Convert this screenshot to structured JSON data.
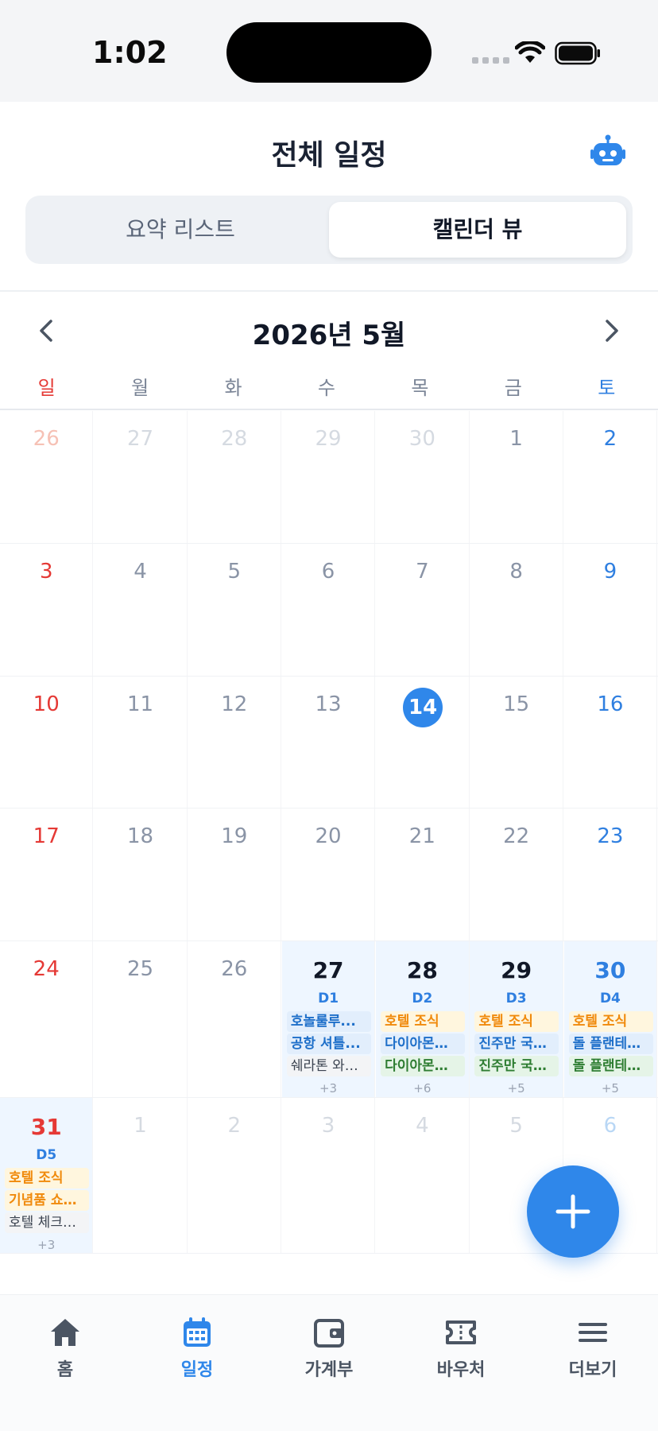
{
  "status_bar": {
    "time": "1:02"
  },
  "header": {
    "title": "전체 일정",
    "assistant_icon": "robot-icon"
  },
  "view_toggle": {
    "list_label": "요약 리스트",
    "calendar_label": "캘린더 뷰",
    "selected": "calendar"
  },
  "calendar": {
    "month_label": "2026년 5월",
    "weekdays": [
      "일",
      "월",
      "화",
      "수",
      "목",
      "금",
      "토"
    ],
    "today": "14",
    "weeks": [
      {
        "days": [
          {
            "n": "26",
            "other": true
          },
          {
            "n": "27",
            "other": true
          },
          {
            "n": "28",
            "other": true
          },
          {
            "n": "29",
            "other": true
          },
          {
            "n": "30",
            "other": true
          },
          {
            "n": "1"
          },
          {
            "n": "2"
          }
        ]
      },
      {
        "days": [
          {
            "n": "3"
          },
          {
            "n": "4"
          },
          {
            "n": "5"
          },
          {
            "n": "6"
          },
          {
            "n": "7"
          },
          {
            "n": "8"
          },
          {
            "n": "9"
          }
        ]
      },
      {
        "days": [
          {
            "n": "10"
          },
          {
            "n": "11"
          },
          {
            "n": "12"
          },
          {
            "n": "13"
          },
          {
            "n": "14",
            "today": true
          },
          {
            "n": "15"
          },
          {
            "n": "16"
          }
        ]
      },
      {
        "days": [
          {
            "n": "17"
          },
          {
            "n": "18"
          },
          {
            "n": "19"
          },
          {
            "n": "20"
          },
          {
            "n": "21"
          },
          {
            "n": "22"
          },
          {
            "n": "23"
          }
        ]
      },
      {
        "days": [
          {
            "n": "24"
          },
          {
            "n": "25"
          },
          {
            "n": "26"
          },
          {
            "n": "27",
            "trip_day": "D1",
            "events": [
              {
                "label": "호놀룰루...",
                "color": "blue"
              },
              {
                "label": "공항 셔틀...",
                "color": "blue"
              },
              {
                "label": "쉐라톤 와…",
                "color": "gray"
              }
            ],
            "more": "+3"
          },
          {
            "n": "28",
            "trip_day": "D2",
            "events": [
              {
                "label": "호텔 조식",
                "color": "orange"
              },
              {
                "label": "다이아몬…",
                "color": "blue"
              },
              {
                "label": "다이아몬…",
                "color": "green"
              }
            ],
            "more": "+6"
          },
          {
            "n": "29",
            "trip_day": "D3",
            "events": [
              {
                "label": "호텔 조식",
                "color": "orange"
              },
              {
                "label": "진주만 국…",
                "color": "blue"
              },
              {
                "label": "진주만 국…",
                "color": "green"
              }
            ],
            "more": "+5"
          },
          {
            "n": "30",
            "trip_day": "D4",
            "events": [
              {
                "label": "호텔 조식",
                "color": "orange"
              },
              {
                "label": "돌 플랜테…",
                "color": "blue"
              },
              {
                "label": "돌 플랜테…",
                "color": "green"
              }
            ],
            "more": "+5"
          }
        ]
      },
      {
        "days": [
          {
            "n": "31",
            "trip_day": "D5",
            "events": [
              {
                "label": "호텔 조식",
                "color": "orange"
              },
              {
                "label": "기념품 쇼…",
                "color": "orange"
              },
              {
                "label": "호텔 체크…",
                "color": "gray"
              }
            ],
            "more": "+3"
          },
          {
            "n": "1",
            "other": true
          },
          {
            "n": "2",
            "other": true
          },
          {
            "n": "3",
            "other": true
          },
          {
            "n": "4",
            "other": true
          },
          {
            "n": "5",
            "other": true
          },
          {
            "n": "6",
            "other": true
          }
        ]
      }
    ]
  },
  "fab": {
    "icon": "plus-icon"
  },
  "tab_bar": {
    "items": [
      {
        "label": "홈",
        "icon": "home-icon"
      },
      {
        "label": "일정",
        "icon": "calendar-icon",
        "active": true
      },
      {
        "label": "가계부",
        "icon": "wallet-icon"
      },
      {
        "label": "바우처",
        "icon": "ticket-icon"
      },
      {
        "label": "더보기",
        "icon": "menu-icon"
      }
    ]
  },
  "colors": {
    "accent": "#2f87ea",
    "sunday": "#e53935",
    "saturday": "#2f7fe0"
  }
}
